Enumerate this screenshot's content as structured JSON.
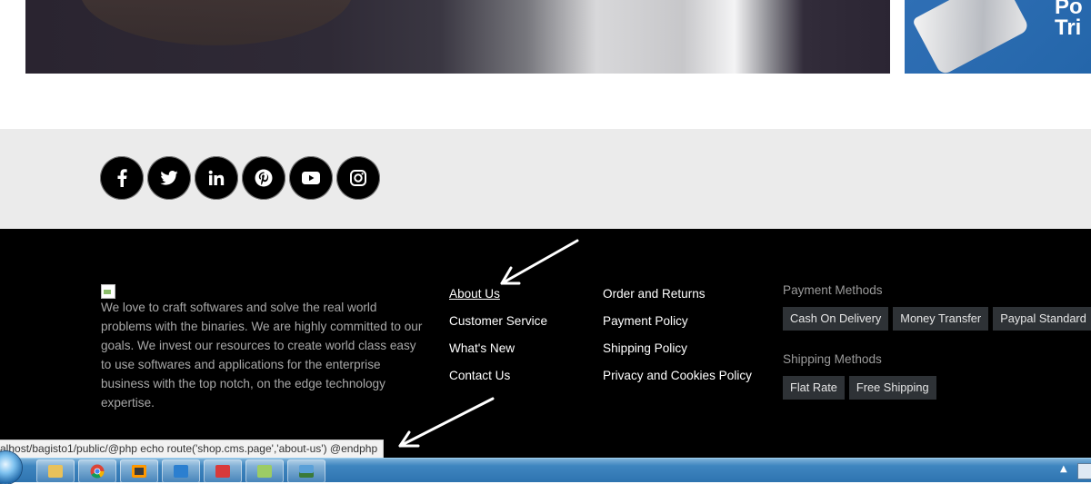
{
  "banner": {
    "promo_text": "Po\nTri"
  },
  "social": {
    "items": [
      {
        "icon": "facebook-icon",
        "glyph": "f"
      },
      {
        "icon": "twitter-icon",
        "glyph": ""
      },
      {
        "icon": "linkedin-icon",
        "glyph": "in"
      },
      {
        "icon": "pinterest-icon",
        "glyph": ""
      },
      {
        "icon": "youtube-icon",
        "glyph": ""
      },
      {
        "icon": "instagram-icon",
        "glyph": ""
      }
    ]
  },
  "footer": {
    "about": "We love to craft softwares and solve the real world problems with the binaries. We are highly committed to our goals. We invest our resources to create world class easy to use softwares and applications for the enterprise business with the top notch, on the edge technology expertise.",
    "links_col1": [
      "About Us",
      "Customer Service",
      "What's New",
      "Contact Us"
    ],
    "links_col2": [
      "Order and Returns",
      "Payment Policy",
      "Shipping Policy",
      "Privacy and Cookies Policy"
    ],
    "payment": {
      "heading": "Payment Methods",
      "items": [
        "Cash On Delivery",
        "Money Transfer",
        "Paypal Standard"
      ]
    },
    "shipping": {
      "heading": "Shipping Methods",
      "items": [
        "Flat Rate",
        "Free Shipping"
      ]
    }
  },
  "status_bar": {
    "url": "alhost/bagisto1/public/@php echo route('shop.cms.page','about-us') @endphp"
  },
  "colors": {
    "footer_bg": "#000000",
    "social_bar_bg": "#ebebeb",
    "badge_bg": "#2e3236"
  },
  "taskbar": {
    "apps": [
      "file-explorer-icon",
      "chrome-icon",
      "sublime-text-icon",
      "app-blue-icon",
      "app-red-icon",
      "folder-app-icon",
      "network-app-icon"
    ]
  }
}
